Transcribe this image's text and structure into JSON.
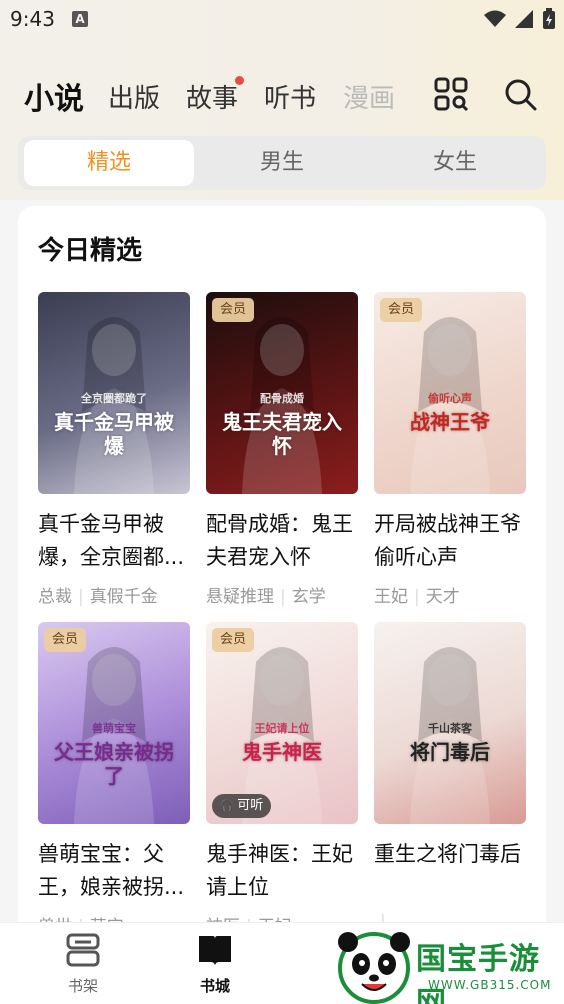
{
  "status": {
    "time": "9:43",
    "notif_glyph": "A"
  },
  "nav": {
    "tabs": [
      {
        "label": "小说",
        "active": true
      },
      {
        "label": "出版",
        "active": false
      },
      {
        "label": "故事",
        "active": false,
        "dot": true
      },
      {
        "label": "听书",
        "active": false
      },
      {
        "label": "漫画",
        "active": false
      }
    ],
    "icons": [
      "apps-grid-icon",
      "search-icon"
    ]
  },
  "segment": {
    "items": [
      {
        "label": "精选",
        "active": true
      },
      {
        "label": "男生",
        "active": false
      },
      {
        "label": "女生",
        "active": false
      }
    ]
  },
  "section": {
    "title": "今日精选",
    "books": [
      {
        "title": "真千金马甲被爆，全京圈都...",
        "tags": [
          "总裁",
          "真假千金"
        ],
        "badge": "",
        "listen": "",
        "cover_text": "真千金马甲被爆",
        "cover_sub": "全京圈都跪了",
        "cover_colors": [
          "#3b3d52",
          "#6a6b86",
          "#c9c6d4"
        ],
        "cover_text_color": "#ffffff"
      },
      {
        "title": "配骨成婚：鬼王夫君宠入怀",
        "tags": [
          "悬疑推理",
          "玄学"
        ],
        "badge": "会员",
        "listen": "",
        "cover_text": "鬼王夫君宠入怀",
        "cover_sub": "配骨成婚",
        "cover_colors": [
          "#1c0d0d",
          "#5a1414",
          "#8c1d1d"
        ],
        "cover_text_color": "#ffffff"
      },
      {
        "title": "开局被战神王爷偷听心声",
        "tags": [
          "王妃",
          "天才"
        ],
        "badge": "会员",
        "listen": "",
        "cover_text": "战神王爷",
        "cover_sub": "偷听心声",
        "cover_colors": [
          "#f6ece6",
          "#efd6cc",
          "#e8c8bd"
        ],
        "cover_text_color": "#c8251f"
      },
      {
        "title": "兽萌宝宝：父王，娘亲被拐...",
        "tags": [
          "兽世",
          "萌宝"
        ],
        "badge": "会员",
        "listen": "",
        "cover_text": "父王娘亲被拐了",
        "cover_sub": "兽萌宝宝",
        "cover_colors": [
          "#d9c9ef",
          "#a98ad8",
          "#7d5fb6"
        ],
        "cover_text_color": "#7a2a8f"
      },
      {
        "title": "鬼手神医：王妃请上位",
        "tags": [
          "神医",
          "王妃"
        ],
        "badge": "会员",
        "listen": "可听",
        "cover_text": "鬼手神医",
        "cover_sub": "王妃请上位",
        "cover_colors": [
          "#f8f2ee",
          "#f0dad8",
          "#e9c2c6"
        ],
        "cover_text_color": "#d01f4a"
      },
      {
        "title": "重生之将门毒后",
        "tags": [
          "",
          ""
        ],
        "badge": "",
        "listen": "",
        "cover_text": "将门毒后",
        "cover_sub": "千山茶客",
        "cover_colors": [
          "#f7f2ef",
          "#ecd9d4",
          "#d89a94"
        ],
        "cover_text_color": "#222222"
      }
    ]
  },
  "bottom_bar": {
    "items": [
      {
        "label": "书架",
        "active": false
      },
      {
        "label": "书城",
        "active": true
      }
    ]
  },
  "watermark": {
    "text": "国宝手游网",
    "sub": "WWW.GB315.COM"
  }
}
